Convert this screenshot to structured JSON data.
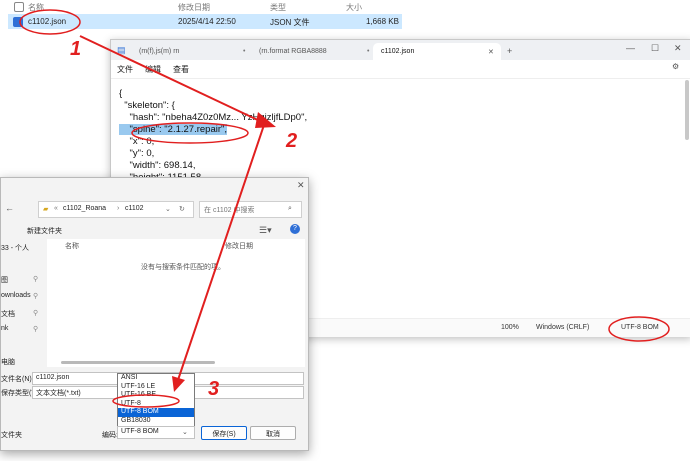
{
  "explorer": {
    "columns": [
      "名称",
      "修改日期",
      "类型",
      "大小"
    ],
    "file": {
      "name": "c1102.json",
      "date": "2025/4/14 22:50",
      "type": "JSON 文件",
      "size": "1,668 KB"
    }
  },
  "notepad": {
    "tabs": [
      "(m(f),js(m)  rn",
      "(rn.format RGBA8888",
      "c1102.json"
    ],
    "add_tab": "+",
    "menu": [
      "文件",
      "编辑",
      "查看"
    ],
    "code_lines": [
      "{",
      "  \"skeleton\": {",
      "    \"hash\": \"nbeha4Z0z0Mz... YzHqizljfLDp0\",",
      "    \"spine\": \"2.1.27.repair\",",
      "    \"x\": 0,",
      "    \"y\": 0,",
      "    \"width\": 698.14,",
      "    \"height\": 1151.58,"
    ],
    "status": {
      "zoom": "100%",
      "eol": "Windows (CRLF)",
      "encoding": "UTF-8 BOM"
    }
  },
  "dialog": {
    "path": [
      "c1102_Roana",
      "c1102"
    ],
    "search_placeholder": "在 c1102 中搜索",
    "new_folder": "新建文件夹",
    "col_name": "名称",
    "col_date": "修改日期",
    "empty_message": "没有与搜索条件匹配的项。",
    "sidebar": [
      "33 - 个人",
      "图",
      "ownloads",
      "文档",
      "nk",
      "电脑"
    ],
    "filename_label": "文件名(N):",
    "filename_value": "c1102.json",
    "filetype_label": "保存类型(T):",
    "filetype_value": "文本文档(*.txt)",
    "encoding_options": [
      "ANSI",
      "UTF-16 LE",
      "UTF-16 BE",
      "UTF-8",
      "UTF-8 BOM",
      "GB18030"
    ],
    "encoding_selected_index": 4,
    "encoding_label": "编码:",
    "encoding_value": "UTF-8 BOM",
    "hide_folders": "文件夹",
    "save_button": "保存(S)",
    "cancel_button": "取消"
  },
  "annotations": {
    "n1": "1",
    "n2": "2",
    "n3": "3",
    "color": "#e11f1f"
  }
}
